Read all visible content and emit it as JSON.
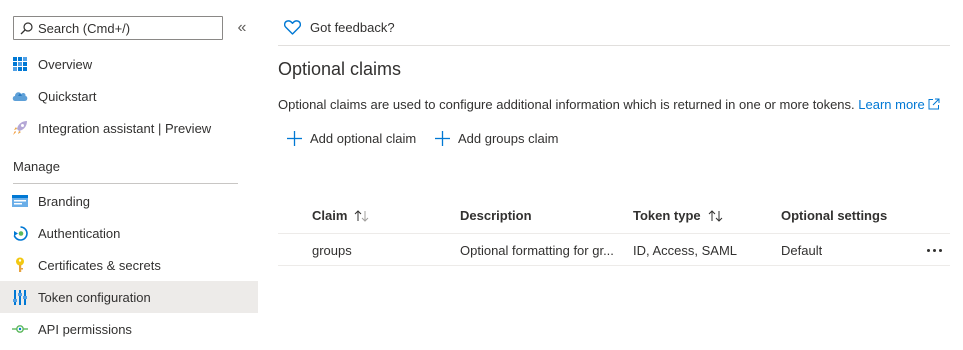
{
  "sidebar": {
    "search": {
      "placeholder": "Search (Cmd+/)",
      "value": ""
    },
    "collapse_glyph": "«",
    "items_top": [
      {
        "label": "Overview",
        "icon": "overview-grid-icon"
      },
      {
        "label": "Quickstart",
        "icon": "quickstart-cloud-icon"
      },
      {
        "label": "Integration assistant | Preview",
        "icon": "rocket-icon"
      }
    ],
    "section": "Manage",
    "items_manage": [
      {
        "label": "Branding",
        "icon": "branding-icon"
      },
      {
        "label": "Authentication",
        "icon": "authentication-icon"
      },
      {
        "label": "Certificates & secrets",
        "icon": "key-icon"
      },
      {
        "label": "Token configuration",
        "icon": "token-config-icon",
        "selected": true
      },
      {
        "label": "API permissions",
        "icon": "api-permissions-icon"
      }
    ]
  },
  "main": {
    "feedback": "Got feedback?",
    "title": "Optional claims",
    "description": "Optional claims are used to configure additional information which is returned in one or more tokens.",
    "learn_more": "Learn more",
    "commands": [
      {
        "label": "Add optional claim"
      },
      {
        "label": "Add groups claim"
      }
    ],
    "table": {
      "columns": [
        "Claim",
        "Description",
        "Token type",
        "Optional settings"
      ],
      "rows": [
        {
          "claim": "groups",
          "description": "Optional formatting for gr...",
          "token_type": "ID, Access, SAML",
          "optional_settings": "Default"
        }
      ]
    }
  },
  "colors": {
    "accent": "#0078d4",
    "selected_bg": "#edebe9",
    "text": "#323130"
  }
}
